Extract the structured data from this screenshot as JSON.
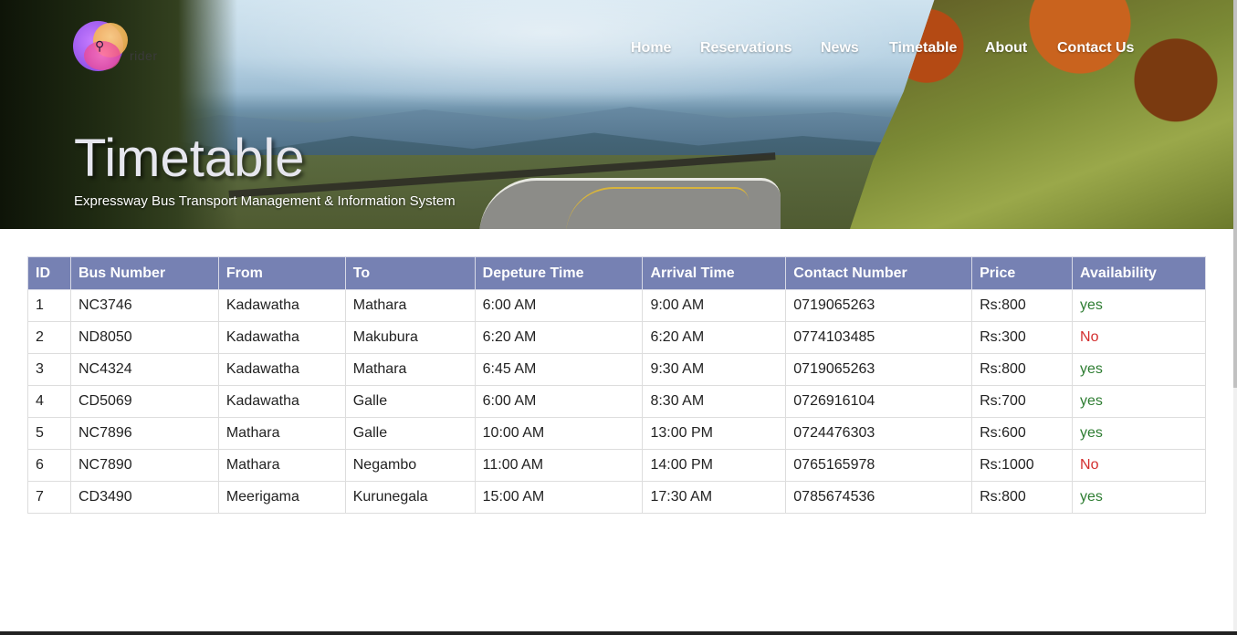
{
  "brand": {
    "name": "rider",
    "logo_icon": "map-pin-icon"
  },
  "nav": {
    "items": [
      {
        "label": "Home",
        "width": 76
      },
      {
        "label": "Reservations",
        "width": 132
      },
      {
        "label": "News",
        "width": 75
      },
      {
        "label": "Timetable",
        "width": 105
      },
      {
        "label": "About",
        "width": 79
      },
      {
        "label": "Contact Us",
        "width": 90
      }
    ]
  },
  "hero": {
    "title": "Timetable",
    "subtitle": "Expressway Bus Transport Management & Information System"
  },
  "table": {
    "headers": [
      "ID",
      "Bus Number",
      "From",
      "To",
      "Depeture Time",
      "Arrival Time",
      "Contact Number",
      "Price",
      "Availability"
    ],
    "rows": [
      [
        "1",
        "NC3746",
        "Kadawatha",
        "Mathara",
        "6:00 AM",
        "9:00 AM",
        "0719065263",
        "Rs:800",
        "yes"
      ],
      [
        "2",
        "ND8050",
        "Kadawatha",
        "Makubura",
        "6:20 AM",
        "6:20 AM",
        "0774103485",
        "Rs:300",
        "No"
      ],
      [
        "3",
        "NC4324",
        "Kadawatha",
        "Mathara",
        "6:45 AM",
        "9:30 AM",
        "0719065263",
        "Rs:800",
        "yes"
      ],
      [
        "4",
        "CD5069",
        "Kadawatha",
        "Galle",
        "6:00 AM",
        "8:30 AM",
        "0726916104",
        "Rs:700",
        "yes"
      ],
      [
        "5",
        "NC7896",
        "Mathara",
        "Galle",
        "10:00 AM",
        "13:00 PM",
        "0724476303",
        "Rs:600",
        "yes"
      ],
      [
        "6",
        "NC7890",
        "Mathara",
        "Negambo",
        "11:00 AM",
        "14:00 PM",
        "0765165978",
        "Rs:1000",
        "No"
      ],
      [
        "7",
        "CD3490",
        "Meerigama",
        "Kurunegala",
        "15:00 AM",
        "17:30 AM",
        "0785674536",
        "Rs:800",
        "yes"
      ]
    ]
  },
  "colors": {
    "header_bg": "#7681b3",
    "available": "#2e7d32",
    "unavailable": "#d32f2f"
  }
}
